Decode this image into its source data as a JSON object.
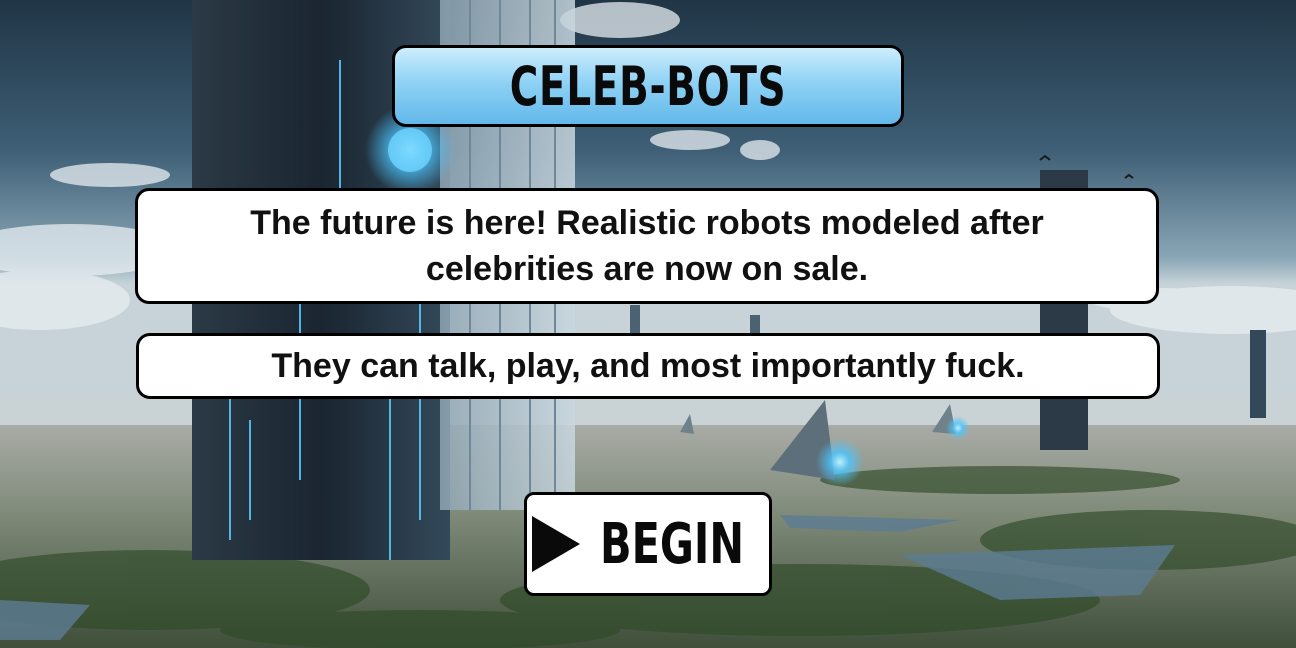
{
  "game": {
    "title": "CELEB-BOTS",
    "intro_text": "The future is here! Realistic robots modeled after celebrities are now on sale.",
    "tagline": "They can talk, play, and most importantly fuck.",
    "begin_label": "BEGIN",
    "begin_icon": "play-triangle-icon"
  },
  "colors": {
    "title_gradient_top": "#cdeefc",
    "title_gradient_bottom": "#63b8ea",
    "panel_fill": "#ffffff",
    "panel_border": "#000000",
    "glow_accent": "#4cc6ff"
  }
}
